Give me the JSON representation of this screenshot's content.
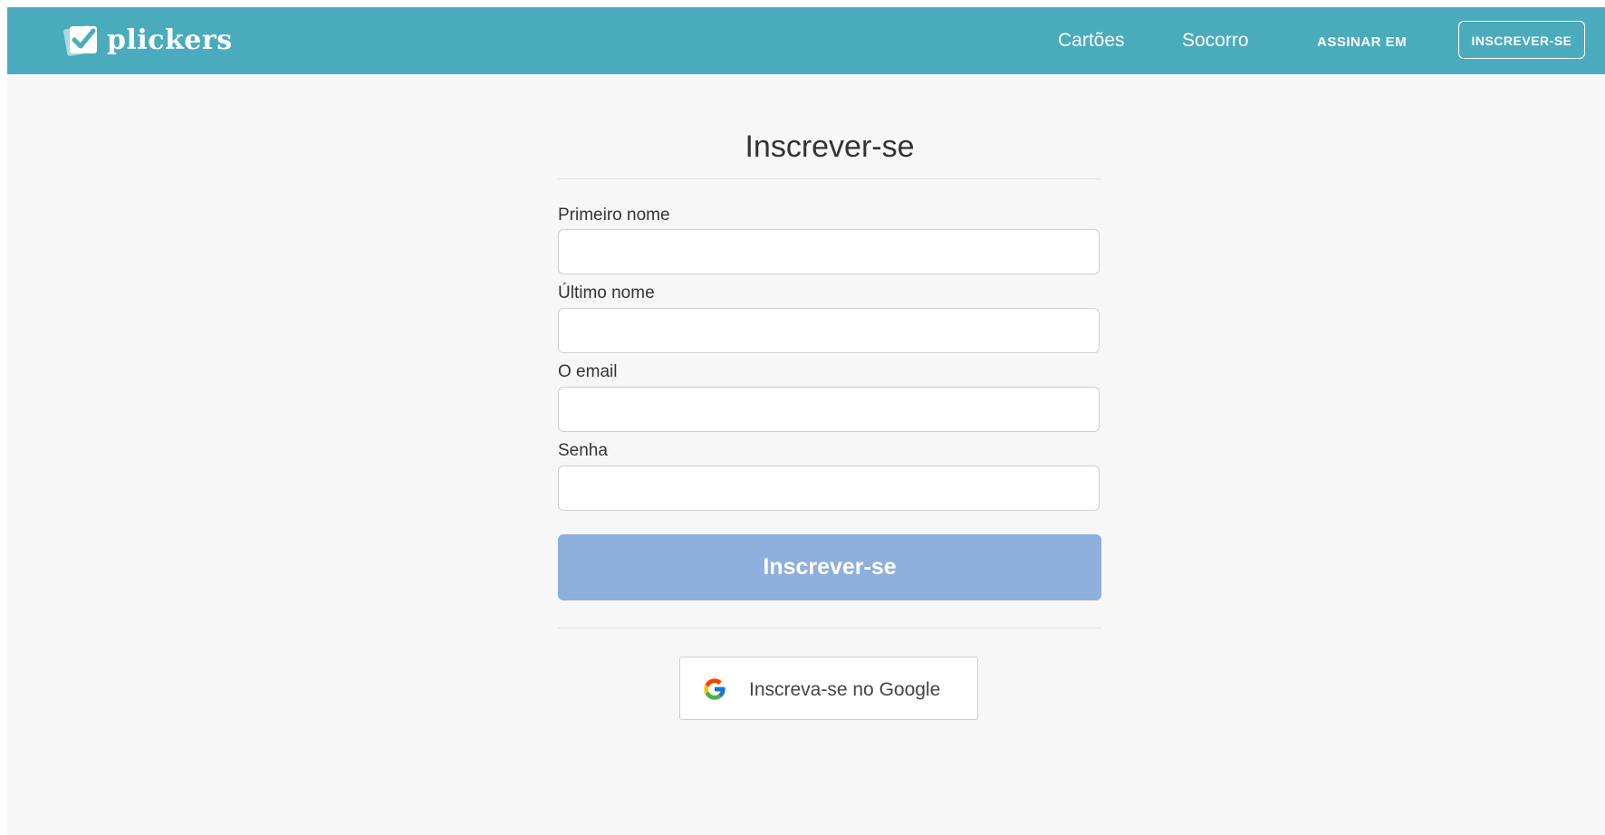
{
  "header": {
    "brand": "plickers",
    "nav": {
      "cards": "Cartões",
      "help": "Socorro",
      "sign_in": "ASSINAR EM",
      "sign_up": "INSCREVER-SE"
    }
  },
  "form": {
    "title": "Inscrever-se",
    "fields": [
      {
        "label": "Primeiro nome",
        "value": ""
      },
      {
        "label": "Último nome",
        "value": ""
      },
      {
        "label": "O email",
        "value": ""
      },
      {
        "label": "Senha",
        "value": ""
      }
    ],
    "submit_label": "Inscrever-se",
    "google_label": "Inscreva-se no Google"
  },
  "colors": {
    "header_bg": "#4aabbd",
    "submit_bg": "#8eafdb",
    "page_bg": "#f7f7f7"
  },
  "icons": {
    "logo": "plickers-check-card-icon",
    "google": "google-g-icon"
  }
}
